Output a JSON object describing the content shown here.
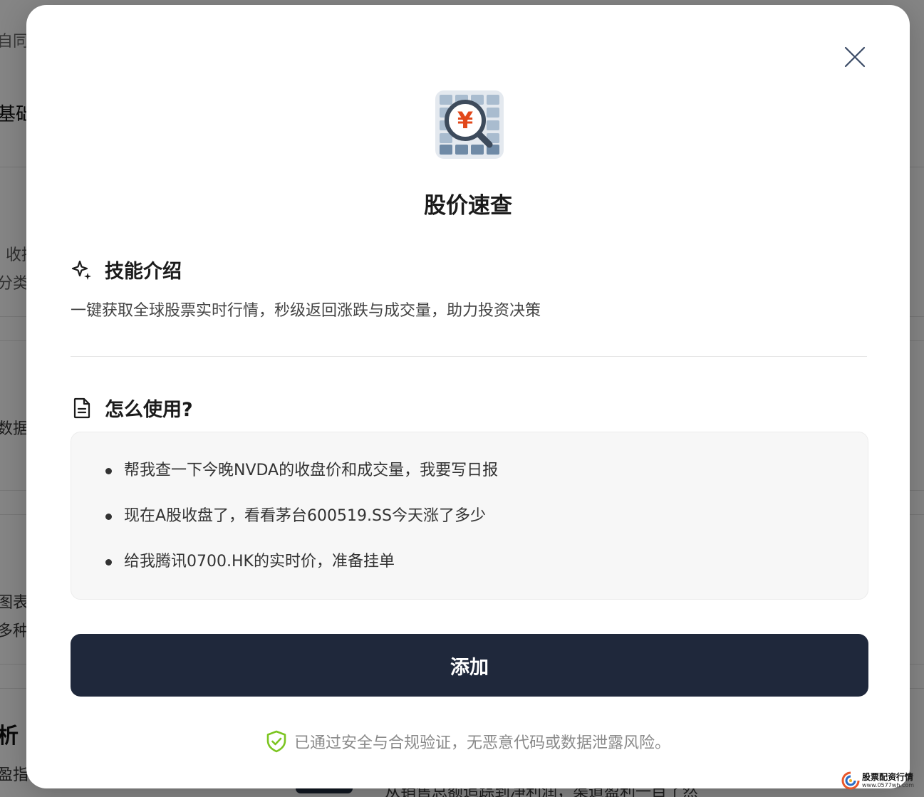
{
  "background": {
    "fragments": [
      "自同",
      "基础",
      "收持",
      "分类，",
      "数据L",
      "图表L",
      "多种",
      "析",
      "盈指标"
    ],
    "bottom_text": "从销售总额追踪到净利润，渠道盈利一目了然"
  },
  "modal": {
    "title": "股价速查",
    "intro": {
      "heading": "技能介绍",
      "text": "一键获取全球股票实时行情，秒级返回涨跌与成交量，助力投资决策"
    },
    "usage": {
      "heading": "怎么使用?",
      "examples": [
        "帮我查一下今晚NVDA的收盘价和成交量，我要写日报",
        "现在A股收盘了，看看茅台600519.SS今天涨了多少",
        "给我腾讯0700.HK的实时价，准备挂单"
      ]
    },
    "add_button": "添加",
    "security_note": "已通过安全与合规验证，无恶意代码或数据泄露风险。",
    "logo_symbol": "¥"
  },
  "watermark": {
    "title": "股票配资行情",
    "url": "www.0577wh.com"
  },
  "colors": {
    "button_bg": "#1f283b",
    "shield": "#7cc521",
    "logo_yen": "#e2471a"
  }
}
